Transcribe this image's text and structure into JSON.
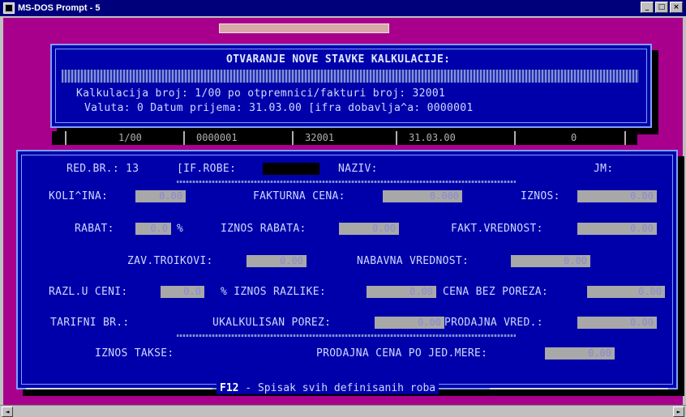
{
  "window": {
    "title": "MS-DOS Prompt - 5",
    "minimize": "_",
    "maximize": "□",
    "close": "×"
  },
  "header": {
    "title": "OTVARANJE NOVE STAVKE KALKULACIJE:",
    "line1": "Kalkulacija broj:    1/00  po otpremnici/fakturi broj: 32001",
    "line2": "Valuta:    0   Datum prijema: 31.03.00  [ifra dobavlja^a: 0000001"
  },
  "strip": {
    "cells": [
      "1/00",
      "0000001",
      "32001",
      "31.03.00",
      "0"
    ]
  },
  "form": {
    "red_br_label": "RED.BR.: 13",
    "sif_robe_label": "[IF.ROBE:",
    "naziv_label": "NAZIV:",
    "jm_label": "JM:",
    "kolicina_label": "KOLI^INA:",
    "kolicina_value": "0.00",
    "fakturna_cena_label": "FAKTURNA CENA:",
    "fakturna_cena_value": "0.000",
    "iznos_label": "IZNOS:",
    "iznos_value": "0.00",
    "rabat_label": "RABAT:",
    "rabat_value": "0.0",
    "rabat_pct": "%",
    "iznos_rabata_label": "IZNOS RABATA:",
    "iznos_rabata_value": "0.00",
    "fakt_vrednost_label": "FAKT.VREDNOST:",
    "fakt_vrednost_value": "0.00",
    "zav_troskovi_label": "ZAV.TROIKOVI:",
    "zav_troskovi_value": "0.00",
    "nabavna_vrednost_label": "NABAVNA VREDNOST:",
    "nabavna_vrednost_value": "0.00",
    "razl_u_ceni_label": "RAZL.U CENI:",
    "razl_u_ceni_value": "0.0",
    "iznos_razlike_label": "% IZNOS RAZLIKE:",
    "iznos_razlike_value": "0.00",
    "cena_bez_poreza_label": "CENA BEZ POREZA:",
    "cena_bez_poreza_value": "0.00",
    "tarifni_br_label": "TARIFNI BR.:",
    "ukalkulisan_porez_label": "UKALKULISAN POREZ:",
    "ukalkulisan_porez_value": "0.00",
    "prodajna_vred_label": "PRODAJNA VRED.:",
    "prodajna_vred_value": "0.00",
    "iznos_takse_label": "IZNOS TAKSE:",
    "prodajna_cena_label": "PRODAJNA CENA PO JED.MERE:",
    "prodajna_cena_value": "0.00"
  },
  "footer": {
    "key": "F12",
    "text": " - Spisak svih definisanih roba"
  },
  "scrollbar": {
    "left": "◄",
    "right": "►"
  }
}
